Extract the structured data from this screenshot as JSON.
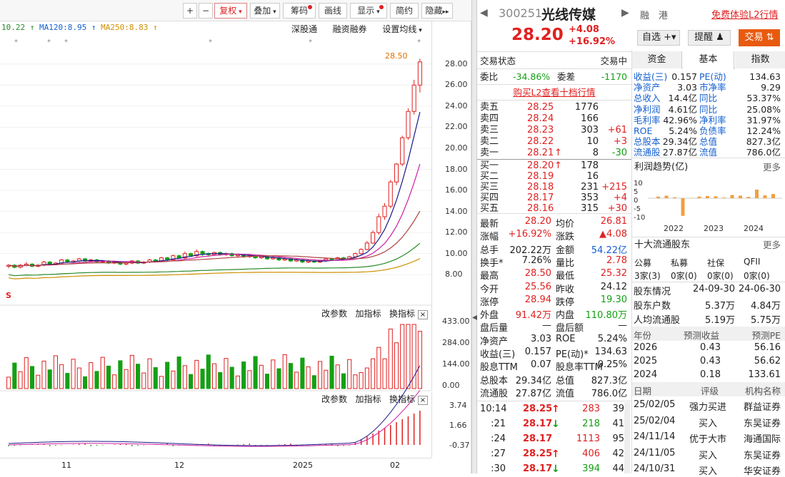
{
  "toolbar": {
    "plus": "+",
    "minus": "−",
    "fuquan": "复权",
    "diejia": "叠加",
    "chouma": "筹码",
    "huaxian": "画线",
    "xianshi": "显示",
    "jianyue": "简约",
    "yincang": "隐藏"
  },
  "ma_labels": [
    "10.22",
    "MA120:8.95",
    "MA250:8.83"
  ],
  "chart_tools": {
    "shengutong": "深股通",
    "rongzi": "融资融券",
    "setma": "设置均线"
  },
  "candle_axis": [
    "28.00",
    "26.00",
    "24.00",
    "22.00",
    "20.00",
    "18.00",
    "16.00",
    "14.00",
    "12.00",
    "10.00",
    "8.00"
  ],
  "high_label": "28.50",
  "vol_tools": {
    "params": "改参数",
    "add": "加指标",
    "change": "换指标",
    "close": "×"
  },
  "vol_axis": [
    "433.00",
    "284.00",
    "144.00",
    "0.00"
  ],
  "macd_tools": {
    "params": "改参数",
    "add": "加指标",
    "change": "换指标",
    "close": "×"
  },
  "macd_axis": [
    "3.74",
    "1.66",
    "-0.37"
  ],
  "x_axis": [
    "11",
    "12",
    "2025",
    "02"
  ],
  "s_mark": "S",
  "chart_data": {
    "type": "candlestick",
    "ylim": [
      7,
      29
    ],
    "candles": [
      [
        8.8,
        8.9,
        8.6,
        9.0
      ],
      [
        8.9,
        8.7,
        8.6,
        9.0
      ],
      [
        8.7,
        8.9,
        8.6,
        9.0
      ],
      [
        8.9,
        9.0,
        8.8,
        9.2
      ],
      [
        9.0,
        8.8,
        8.7,
        9.1
      ],
      [
        8.8,
        8.9,
        8.7,
        9.0
      ],
      [
        8.9,
        9.2,
        8.8,
        9.3
      ],
      [
        9.2,
        9.0,
        8.9,
        9.3
      ],
      [
        9.0,
        9.1,
        8.9,
        9.2
      ],
      [
        9.1,
        9.4,
        9.0,
        9.5
      ],
      [
        9.4,
        9.2,
        9.1,
        9.5
      ],
      [
        9.2,
        9.3,
        9.1,
        9.4
      ],
      [
        9.3,
        9.5,
        9.2,
        9.6
      ],
      [
        9.5,
        9.3,
        9.2,
        9.6
      ],
      [
        9.3,
        9.4,
        9.2,
        9.5
      ],
      [
        9.4,
        9.2,
        9.1,
        9.5
      ],
      [
        9.2,
        9.3,
        9.1,
        9.4
      ],
      [
        9.3,
        9.1,
        9.0,
        9.4
      ],
      [
        9.1,
        9.2,
        9.0,
        9.3
      ],
      [
        9.2,
        9.0,
        8.9,
        9.3
      ],
      [
        9.0,
        9.1,
        8.9,
        9.2
      ],
      [
        9.1,
        9.3,
        9.0,
        9.4
      ],
      [
        9.3,
        9.1,
        9.0,
        9.4
      ],
      [
        9.1,
        9.2,
        9.0,
        9.3
      ],
      [
        9.2,
        9.4,
        9.1,
        9.5
      ],
      [
        9.4,
        9.3,
        9.2,
        9.5
      ],
      [
        9.3,
        9.6,
        9.2,
        9.7
      ],
      [
        9.6,
        9.4,
        9.3,
        9.7
      ],
      [
        9.4,
        9.8,
        9.3,
        9.9
      ],
      [
        9.8,
        9.6,
        9.5,
        9.9
      ],
      [
        9.6,
        10.0,
        9.5,
        10.2
      ],
      [
        10.0,
        9.8,
        9.7,
        10.1
      ],
      [
        9.8,
        10.2,
        9.7,
        10.4
      ],
      [
        10.2,
        10.0,
        9.8,
        10.3
      ],
      [
        10.0,
        9.9,
        9.7,
        10.1
      ],
      [
        9.9,
        10.1,
        9.8,
        10.2
      ],
      [
        10.1,
        9.9,
        9.8,
        10.2
      ],
      [
        9.9,
        10.0,
        9.8,
        10.1
      ],
      [
        10.0,
        9.8,
        9.7,
        10.1
      ],
      [
        9.8,
        9.9,
        9.7,
        10.0
      ],
      [
        9.9,
        9.7,
        9.6,
        10.0
      ],
      [
        9.7,
        9.8,
        9.6,
        9.9
      ],
      [
        9.8,
        9.6,
        9.5,
        9.9
      ],
      [
        9.6,
        9.7,
        9.5,
        9.8
      ],
      [
        9.7,
        9.5,
        9.4,
        9.8
      ],
      [
        9.5,
        9.6,
        9.4,
        9.7
      ],
      [
        9.6,
        9.4,
        9.3,
        9.7
      ],
      [
        9.4,
        9.5,
        9.3,
        9.6
      ],
      [
        9.5,
        9.3,
        9.2,
        9.6
      ],
      [
        9.3,
        9.4,
        9.2,
        9.5
      ],
      [
        9.4,
        9.2,
        9.1,
        9.5
      ],
      [
        9.2,
        9.3,
        9.1,
        9.4
      ],
      [
        9.3,
        9.2,
        9.1,
        9.4
      ],
      [
        9.2,
        9.3,
        9.1,
        9.4
      ],
      [
        9.3,
        9.5,
        9.2,
        9.6
      ],
      [
        9.5,
        9.4,
        9.3,
        9.6
      ],
      [
        9.4,
        9.6,
        9.3,
        9.7
      ],
      [
        9.6,
        9.5,
        9.4,
        9.7
      ],
      [
        9.5,
        9.7,
        9.4,
        9.8
      ],
      [
        9.7,
        10.0,
        9.6,
        10.1
      ],
      [
        10.0,
        10.4,
        9.9,
        10.5
      ],
      [
        10.4,
        11.0,
        10.3,
        11.2
      ],
      [
        11.0,
        12.0,
        10.9,
        12.2
      ],
      [
        12.0,
        13.5,
        11.8,
        13.8
      ],
      [
        13.5,
        14.5,
        13.2,
        14.8
      ],
      [
        14.5,
        16.8,
        14.3,
        17.0
      ],
      [
        16.8,
        18.5,
        16.5,
        18.6
      ],
      [
        18.5,
        21.0,
        18.3,
        21.2
      ],
      [
        21.0,
        23.5,
        20.8,
        23.8
      ],
      [
        23.5,
        26.0,
        23.2,
        26.5
      ],
      [
        26.0,
        28.2,
        25.3,
        28.5
      ]
    ]
  },
  "quote": {
    "code": "300251",
    "name": "光线传媒",
    "rong": "融",
    "gang": "港",
    "free_l2": "免费体验L2行情",
    "price": "28.20",
    "change": "+4.08",
    "pct": "+16.92%",
    "zixuan": "自选",
    "tixing": "提醒",
    "jiaoyi": "交易"
  },
  "status": {
    "label": "交易状态",
    "value": "交易中"
  },
  "weibi": {
    "wb_label": "委比",
    "wb_value": "-34.86%",
    "wc_label": "委差",
    "wc_value": "-1170"
  },
  "buy_l2": "购买L2查看十档行情",
  "asks": [
    {
      "label": "卖五",
      "price": "28.25",
      "vol": "1776",
      "chg": "",
      "arrow": ""
    },
    {
      "label": "卖四",
      "price": "28.24",
      "vol": "166",
      "chg": "",
      "arrow": ""
    },
    {
      "label": "卖三",
      "price": "28.23",
      "vol": "303",
      "chg": "+61",
      "arrow": ""
    },
    {
      "label": "卖二",
      "price": "28.22",
      "vol": "10",
      "chg": "+3",
      "arrow": ""
    },
    {
      "label": "卖一",
      "price": "28.21",
      "vol": "8",
      "chg": "-30",
      "arrow": "↑"
    }
  ],
  "bids": [
    {
      "label": "买一",
      "price": "28.20",
      "vol": "178",
      "chg": "",
      "arrow": "↑"
    },
    {
      "label": "买二",
      "price": "28.19",
      "vol": "16",
      "chg": "",
      "arrow": ""
    },
    {
      "label": "买三",
      "price": "28.18",
      "vol": "231",
      "chg": "+215",
      "arrow": ""
    },
    {
      "label": "买四",
      "price": "28.17",
      "vol": "353",
      "chg": "+4",
      "arrow": ""
    },
    {
      "label": "买五",
      "price": "28.16",
      "vol": "315",
      "chg": "+30",
      "arrow": ""
    }
  ],
  "stats": [
    {
      "l1": "最新",
      "v1": "28.20",
      "c1": "red",
      "l2": "均价",
      "v2": "26.81",
      "c2": "red"
    },
    {
      "l1": "涨幅",
      "v1": "+16.92%",
      "c1": "red",
      "l2": "涨跌",
      "v2": "▲4.08",
      "c2": "red"
    },
    {
      "l1": "总手",
      "v1": "202.22万",
      "c1": "",
      "l2": "金额",
      "v2": "54.22亿",
      "c2": "blu"
    },
    {
      "l1": "换手*",
      "v1": "7.26%",
      "c1": "",
      "l2": "量比",
      "v2": "2.78",
      "c2": "red"
    },
    {
      "l1": "最高",
      "v1": "28.50",
      "c1": "red",
      "l2": "最低",
      "v2": "25.32",
      "c2": "red"
    },
    {
      "l1": "今开",
      "v1": "25.56",
      "c1": "red",
      "l2": "昨收",
      "v2": "24.12",
      "c2": ""
    },
    {
      "l1": "涨停",
      "v1": "28.94",
      "c1": "red",
      "l2": "跌停",
      "v2": "19.30",
      "c2": "grn"
    },
    {
      "l1": "外盘",
      "v1": "91.42万",
      "c1": "red",
      "l2": "内盘",
      "v2": "110.80万",
      "c2": "grn"
    },
    {
      "l1": "盘后量",
      "v1": "—",
      "c1": "",
      "l2": "盘后额",
      "v2": "—",
      "c2": ""
    },
    {
      "l1": "净资产",
      "v1": "3.03",
      "c1": "",
      "l2": "ROE",
      "v2": "5.24%",
      "c2": ""
    },
    {
      "l1": "收益(三)",
      "v1": "0.157",
      "c1": "",
      "l2": "PE(动)*",
      "v2": "134.63",
      "c2": ""
    },
    {
      "l1": "股息TTM",
      "v1": "0.07",
      "c1": "",
      "l2": "股息率TTM",
      "v2": "0.25%",
      "c2": ""
    },
    {
      "l1": "总股本",
      "v1": "29.34亿",
      "c1": "",
      "l2": "总值",
      "v2": "827.3亿",
      "c2": ""
    },
    {
      "l1": "流通股",
      "v1": "27.87亿",
      "c1": "",
      "l2": "流值",
      "v2": "786.0亿",
      "c2": ""
    }
  ],
  "ticks": [
    {
      "time": "10:14",
      "price": "28.25",
      "arrow": "↑",
      "vol": "283",
      "n": "39",
      "c": "red"
    },
    {
      "time": ":21",
      "price": "28.17",
      "arrow": "↓",
      "vol": "218",
      "n": "41",
      "c": "grn"
    },
    {
      "time": ":24",
      "price": "28.17",
      "arrow": "",
      "vol": "1113",
      "n": "95",
      "c": "red"
    },
    {
      "time": ":27",
      "price": "28.25",
      "arrow": "↑",
      "vol": "406",
      "n": "42",
      "c": "red"
    },
    {
      "time": ":30",
      "price": "28.17",
      "arrow": "↓",
      "vol": "394",
      "n": "44",
      "c": "grn"
    }
  ],
  "fin_tabs": [
    "资金",
    "基本",
    "指数"
  ],
  "fin": [
    [
      "收益(三)",
      "0.157",
      "PE(动)",
      "134.63"
    ],
    [
      "净资产",
      "3.03",
      "市净率",
      "9.29"
    ],
    [
      "总收入",
      "14.4亿",
      "同比",
      "53.37%"
    ],
    [
      "净利润",
      "4.61亿",
      "同比",
      "25.08%"
    ],
    [
      "毛利率",
      "42.96%",
      "净利率",
      "31.97%"
    ],
    [
      "ROE",
      "5.24%",
      "负债率",
      "12.24%"
    ],
    [
      "总股本",
      "29.34亿",
      "总值",
      "827.3亿"
    ],
    [
      "流通股",
      "27.87亿",
      "流值",
      "786.0亿"
    ]
  ],
  "profit": {
    "title": "利润趋势(亿)",
    "more": "更多",
    "yaxis": [
      "10",
      "5",
      "0",
      "-5",
      "-10"
    ],
    "xaxis": [
      "2022",
      "2023",
      "2024"
    ],
    "values": [
      0.5,
      0.8,
      0.3,
      -5.5,
      0.1,
      0.5,
      0.7,
      0.6,
      0.2,
      1.0,
      0.8,
      0.4,
      2.7,
      0.9,
      1.3
    ]
  },
  "holders": {
    "title": "十大流通股东",
    "more": "更多",
    "heads": [
      "公募",
      "私募",
      "社保",
      "QFII"
    ],
    "vals": [
      "3家(3)",
      "0家(0)",
      "0家(0)",
      "0家(0)"
    ]
  },
  "holder_rows": [
    [
      "股东情况",
      "24-09-30",
      "24-06-30"
    ],
    [
      "股东户数",
      "5.37万",
      "4.84万"
    ],
    [
      "人均流通股",
      "5.19万",
      "5.75万"
    ]
  ],
  "forecast": {
    "heads": [
      "年份",
      "预测收益",
      "预测PE"
    ],
    "rows": [
      [
        "2026",
        "0.43",
        "56.16"
      ],
      [
        "2025",
        "0.43",
        "56.62"
      ],
      [
        "2024",
        "0.18",
        "133.61"
      ]
    ]
  },
  "ratings": {
    "heads": [
      "日期",
      "评级",
      "机构名称"
    ],
    "rows": [
      [
        "25/02/05",
        "强力买进",
        "群益证券"
      ],
      [
        "25/02/04",
        "买入",
        "东吴证券"
      ],
      [
        "24/11/14",
        "优于大市",
        "海通国际"
      ],
      [
        "24/11/05",
        "买入",
        "东吴证券"
      ],
      [
        "24/10/31",
        "买入",
        "华安证券"
      ]
    ]
  }
}
